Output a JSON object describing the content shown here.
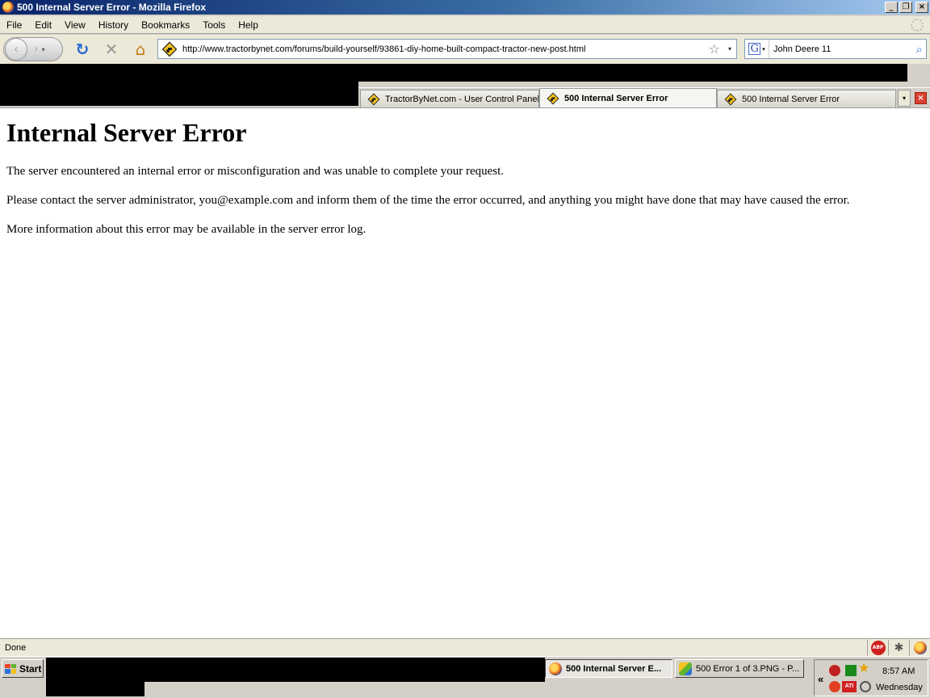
{
  "window": {
    "title": "500 Internal Server Error - Mozilla Firefox",
    "buttons": {
      "minimize": "_",
      "restore": "❐",
      "close": "×"
    }
  },
  "menu": [
    "File",
    "Edit",
    "View",
    "History",
    "Bookmarks",
    "Tools",
    "Help"
  ],
  "nav": {
    "url": "http://www.tractorbynet.com/forums/build-yourself/93861-diy-home-built-compact-tractor-new-post.html",
    "search_value": "John Deere 11"
  },
  "tabs": [
    {
      "label": "TractorByNet.com - User Control Panel",
      "active": false
    },
    {
      "label": "500 Internal Server Error",
      "active": true
    },
    {
      "label": "500 Internal Server Error",
      "active": false
    }
  ],
  "page": {
    "heading": "Internal Server Error",
    "paragraphs": [
      "The server encountered an internal error or misconfiguration and was unable to complete your request.",
      "Please contact the server administrator, you@example.com and inform them of the time the error occurred, and anything you might have done that may have caused the error.",
      "More information about this error may be available in the server error log."
    ]
  },
  "status": {
    "text": "Done",
    "abp_label": "ABP"
  },
  "taskbar": {
    "start_label": "Start",
    "buttons": [
      {
        "label": "500 Internal Server E...",
        "active": true
      },
      {
        "label": "500 Error 1 of 3.PNG - P...",
        "active": false
      }
    ],
    "tray": {
      "ati_label": "ATI",
      "time": "8:57 AM",
      "day": "Wednesday"
    }
  },
  "colors": {
    "title_gradient_start": "#0a246a",
    "title_gradient_end": "#a6caf0",
    "redaction": "#000000"
  }
}
